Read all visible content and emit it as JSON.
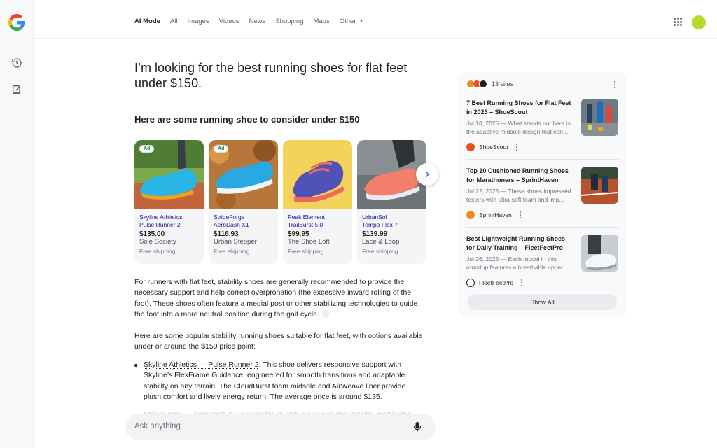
{
  "nav": {
    "tabs": [
      "AI Mode",
      "All",
      "Images",
      "Videos",
      "News",
      "Shopping",
      "Maps",
      "Other"
    ],
    "active_tab": "AI Mode"
  },
  "rail": {
    "icons": [
      "history-icon",
      "new-chat-icon"
    ]
  },
  "query": "I’m looking for the best running shoes for flat feet under $150.",
  "shoe_section_heading": "Here are some running shoe to consider under $150",
  "products": [
    {
      "ad": "Ad",
      "brand": "Skyline Athletics",
      "model": "Pulse Runner 2",
      "price": "$135.00",
      "seller": "Sole Society",
      "shipping": "Free shipping"
    },
    {
      "ad": "Ad",
      "brand": "StrideForge",
      "model": "AeroDash X1",
      "price": "$116.93",
      "seller": "Urban Stepper",
      "shipping": "Free shipping"
    },
    {
      "ad": "",
      "brand": "Peak Element",
      "model": "TrailBurst 5.0",
      "price": "$99.95",
      "seller": "The Shoe Loft",
      "shipping": "Free shipping"
    },
    {
      "ad": "",
      "brand": "UrbanSol",
      "model": "Tempo Flex 7",
      "price": "$139.99",
      "seller": "Lace & Loop",
      "shipping": "Free shipping"
    }
  ],
  "answer": {
    "para1": "For runners with flat feet, stability shoes are generally recommended to provide the necessary support and help correct overpronation (the excessive inward rolling of the foot). These shoes often feature a medial post or other stabilizing technologies to guide the foot into a more neutral position during the gait cycle.",
    "para2": "Here are some popular stability running shoes suitable for flat feet, with options available under or around the $150 price point:",
    "bullet1_link": "Skyline Athletics — Pulse Runner 2",
    "bullet1_text": ": This shoe delivers responsive support with Skyline’s FlexFrame Guidance, engineered for smooth transitions and adaptable stability on any terrain. The CloudBurst foam midsole and AirWeave liner provide plush comfort and lively energy return. The average price is around $135.",
    "bullet2_faded": "StrideForge — AeroDash X1: Known for its stable ride and dependable cushioning"
  },
  "ask": {
    "placeholder": "Ask anything"
  },
  "sources": {
    "count_label": "13 sites",
    "items": [
      {
        "title": "7 Best Running Shoes for Flat Feet in 2025 – ShoeScout",
        "snippet": "Jul 18, 2025 — What stands out here is the adaptive midsole design that con...",
        "site": "ShoeScout",
        "color": "#e8501f"
      },
      {
        "title": "Top 10 Cushioned Running Shoes for Marathoners – SprintHaven",
        "snippet": "Jul 22, 2025 — These shoes impressed testers with ultra-soft foam and imp...",
        "site": "SprintHaven",
        "color": "#f08a1c"
      },
      {
        "title": "Best Lightweight Running Shoes for Daily Training – FleetFeetPro",
        "snippet": "Jul 26, 2025 — Each model in this roundup features a breathable upper...",
        "site": "FleetFeetPro",
        "color": "#202124"
      }
    ],
    "show_all": "Show All"
  }
}
